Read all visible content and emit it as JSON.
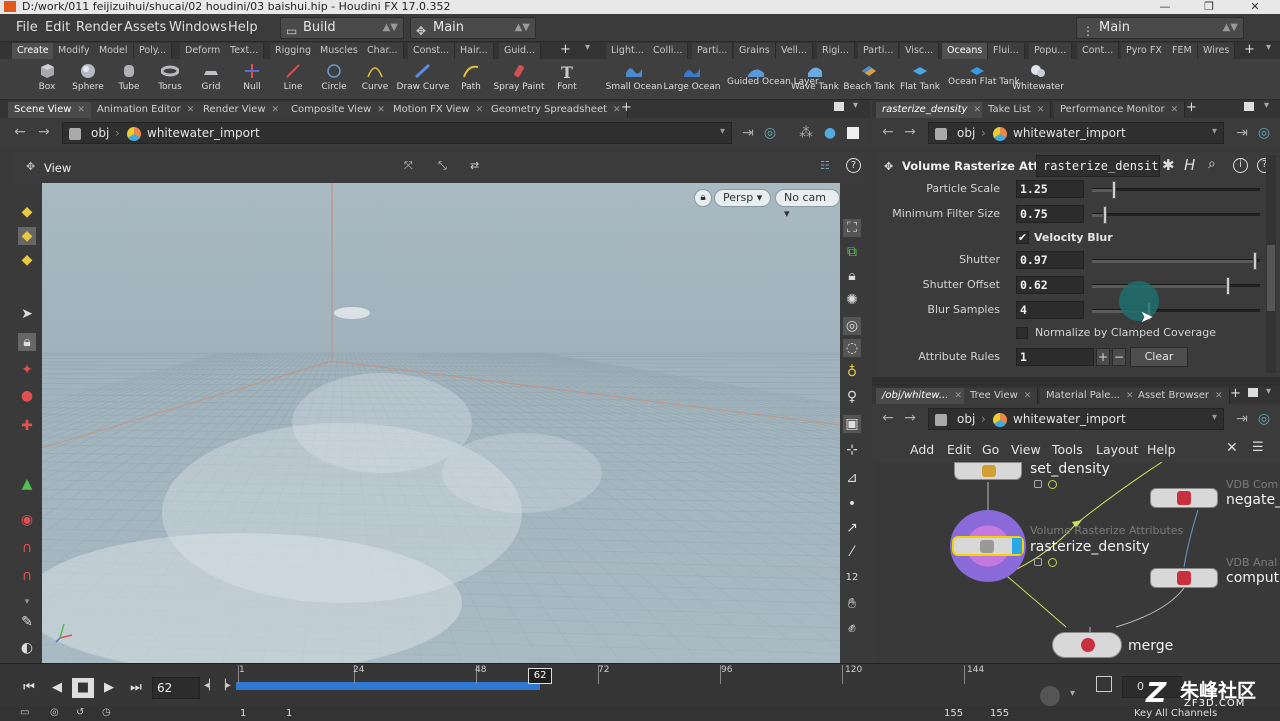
{
  "window": {
    "title": "D:/work/011 feijizuihui/shucai/02 houdini/03 baishui.hip - Houdini FX 17.0.352"
  },
  "menubar": {
    "items": [
      "File",
      "Edit",
      "Render",
      "Assets",
      "Windows",
      "Help"
    ],
    "desktop": "Build",
    "shelf_set": "Main",
    "right_desktop": "Main"
  },
  "shelf_left": {
    "tabs": [
      "Create",
      "Modify",
      "Model",
      "Poly...",
      "Deform",
      "Text...",
      "Rigging",
      "Muscles",
      "Char...",
      "Const...",
      "Hair...",
      "Guid..."
    ],
    "active_tab": "Create",
    "tools": [
      "Box",
      "Sphere",
      "Tube",
      "Torus",
      "Grid",
      "Null",
      "Line",
      "Circle",
      "Curve",
      "Draw Curve",
      "Path",
      "Spray Paint",
      "Font"
    ]
  },
  "shelf_right": {
    "tabs": [
      "Light...",
      "Colli...",
      "Parti...",
      "Grains",
      "Vell...",
      "Rigi...",
      "Parti...",
      "Visc...",
      "Oceans",
      "Flui...",
      "Popu...",
      "Cont...",
      "Pyro FX",
      "FEM",
      "Wires"
    ],
    "active_tab": "Oceans",
    "tools": [
      "Small Ocean",
      "Large Ocean",
      "Guided Ocean Layer",
      "Wave Tank",
      "Beach Tank",
      "Flat Tank",
      "Ocean Flat Tank",
      "Whitewater"
    ]
  },
  "left_pane": {
    "tabs": [
      "Scene View",
      "Animation Editor",
      "Render View",
      "Composite View",
      "Motion FX View",
      "Geometry Spreadsheet"
    ],
    "active_tab": "Scene View",
    "path": {
      "root": "obj",
      "node": "whitewater_import"
    },
    "view_label": "View",
    "persp": "Persp",
    "cam": "No cam"
  },
  "param_pane": {
    "tabs": [
      "rasterize_density",
      "Take List",
      "Performance Monitor"
    ],
    "active_tab": "rasterize_density",
    "path": {
      "root": "obj",
      "node": "whitewater_import"
    },
    "node_type": "Volume Rasterize Attri...",
    "node_name": "rasterize_densit",
    "params": {
      "particle_scale": {
        "label": "Particle Scale",
        "value": "1.25",
        "slider_fraction": 0.13
      },
      "min_filter_size": {
        "label": "Minimum Filter Size",
        "value": "0.75",
        "slider_fraction": 0.08
      },
      "velocity_blur": {
        "label": "Velocity Blur",
        "checked": true
      },
      "shutter": {
        "label": "Shutter",
        "value": "0.97",
        "slider_fraction": 0.97
      },
      "shutter_offset": {
        "label": "Shutter Offset",
        "value": "0.62",
        "slider_fraction": 0.81
      },
      "blur_samples": {
        "label": "Blur Samples",
        "value": "4",
        "slider_fraction": 0.34
      },
      "normalize": {
        "label": "Normalize by Clamped Coverage",
        "checked": false
      },
      "attribute_rules": {
        "label": "Attribute Rules",
        "value": "1",
        "clear": "Clear"
      }
    }
  },
  "network_pane": {
    "tabs": [
      "/obj/whitew...",
      "Tree View",
      "Material Pale...",
      "Asset Browser"
    ],
    "active_tab": "/obj/whitew...",
    "path": {
      "root": "obj",
      "node": "whitewater_import"
    },
    "menu": [
      "Add",
      "Edit",
      "Go",
      "View",
      "Tools",
      "Layout",
      "Help"
    ],
    "nodes": {
      "set_density": "set_density",
      "rasterize": "rasterize_density",
      "rasterize_sub": "Volume Rasterize Attributes",
      "negate": "negate_",
      "negate_sub": "VDB Com",
      "compute": "comput",
      "compute_sub": "VDB Anal",
      "merge": "merge"
    }
  },
  "timeline": {
    "current_frame": "62",
    "ticks": [
      "1",
      "24",
      "48",
      "72",
      "96",
      "120",
      "144"
    ],
    "playhead_fraction": 0.385,
    "start": "1",
    "start2": "1",
    "end": "155",
    "end2": "155",
    "key_all": "Key All Channels",
    "channel_value": "0"
  },
  "watermark": {
    "cn": "朱峰社区",
    "url": "ZF3D.COM"
  },
  "colors": {
    "accent": "#2d7bd6",
    "node_selected": "#f2d400",
    "active_tab": "#505050",
    "timeline_blue": "#2e78d4"
  }
}
